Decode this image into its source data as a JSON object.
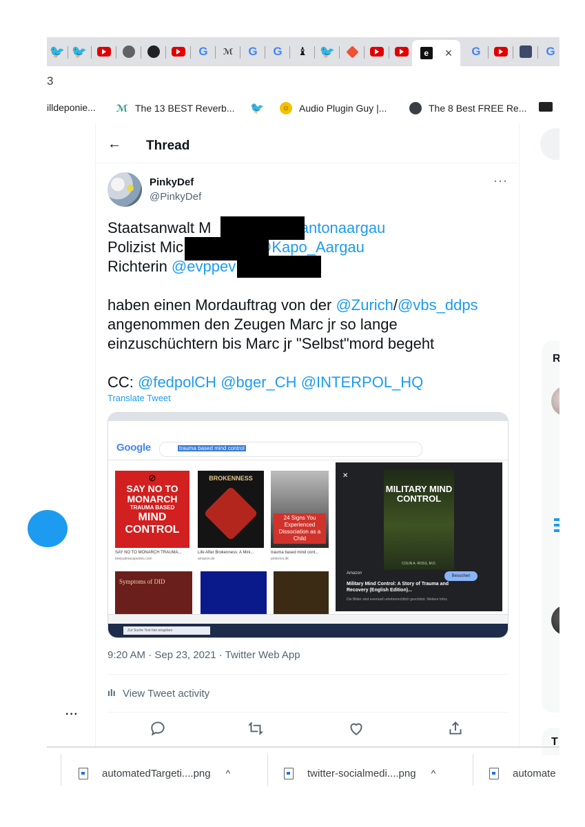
{
  "browser": {
    "active_tab_close": "×",
    "address_fragment": "3",
    "bookmarks": [
      {
        "label": "illdeponie..."
      },
      {
        "label": "The 13 BEST Reverb..."
      },
      {
        "label": "Audio Plugin Guy |..."
      },
      {
        "label": "The 8 Best FREE Re..."
      }
    ]
  },
  "header": {
    "back_icon": "←",
    "title": "Thread"
  },
  "tweet": {
    "display_name": "PinkyDef",
    "handle": "@PinkyDef",
    "more": "···",
    "lines": {
      "l1_text": "Staatsanwalt M",
      "l1_mention": "@kantonaargau",
      "l2_text": "Polizist Mic",
      "l2_mention": "@Kapo_Aargau",
      "l3_text": "Richterin ",
      "l3_mention": "@evppev",
      "l4_text": "haben einen Mordauftrag von der ",
      "l4_mention1": "@Zurich",
      "l4_slash": "/",
      "l4_mention2": "@vbs_ddps",
      "l5_text": "angenommen den Zeugen Marc jr so lange",
      "l6_text": "einzuschüchtern bis Marc jr \"Selbst\"mord begeht",
      "cc_label": "CC: ",
      "cc_m1": "@fedpolCH",
      "cc_m2": "@bger_CH",
      "cc_m3": "@INTERPOL_HQ"
    },
    "translate": "Translate Tweet",
    "timestamp": "9:20 AM · Sep 23, 2021 · Twitter Web App",
    "activity": "View Tweet activity"
  },
  "media": {
    "google_logo": "Google",
    "search_query": "trauma based mind control",
    "tile1_lines": [
      "SAY NO TO",
      "MONARCH",
      "TRAUMA BASED",
      "MIND",
      "CONTROL"
    ],
    "tile1_caption": "SAY NO TO MONARCH TRAUMA...",
    "tile1_source": "beejcatmasspostes.com",
    "tile2_title": "BROKENNESS",
    "tile2_caption": "Life After Brokenness: A Mini...",
    "tile2_source": "amazon.de",
    "tile3_text": "24 Signs You Experienced Dissociation as a Child",
    "tile3_caption": "trauma based mind cont...",
    "tile3_source": "pinterest.dk",
    "tile4_title": "Symptoms of DID",
    "panel_book_title": "MILITARY MIND CONTROL",
    "panel_book_author": "COLIN A. ROSS, M.D.",
    "panel_source": "Amazon",
    "panel_title": "Military Mind Control: A Story of Trauma and Recovery (English Edition)...",
    "panel_note": "Die Bilder sind eventuell urheberrechtlich geschützt.  Weitere Infos",
    "panel_buy": "Besuchen",
    "taskbar_search": "Zur Suche Text hier eingeben"
  },
  "sidebar": {
    "right_heading": "R",
    "right_heading2": "T"
  },
  "downloads": [
    {
      "name": "automatedTargeti....png"
    },
    {
      "name": "twitter-socialmedi....png"
    },
    {
      "name": "automate"
    }
  ],
  "colors": {
    "twitter_blue": "#1d9bf0",
    "text": "#0f1419",
    "muted": "#536471"
  }
}
